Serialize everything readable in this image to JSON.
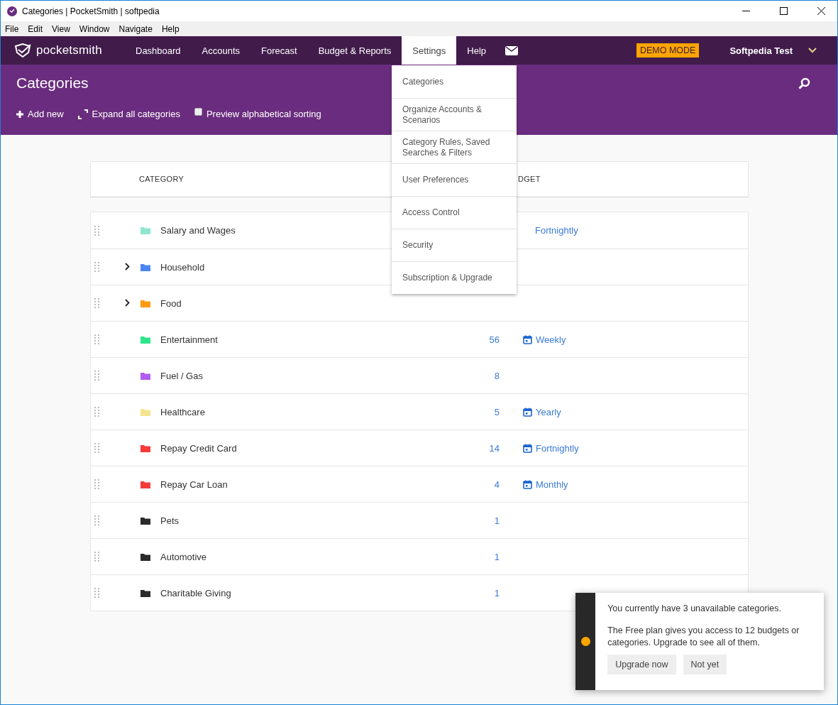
{
  "window": {
    "title": "Categories | PocketSmith | softpedia"
  },
  "menubar": [
    "File",
    "Edit",
    "View",
    "Window",
    "Navigate",
    "Help"
  ],
  "nav": {
    "brand": "pocketsmith",
    "items": [
      {
        "label": "Dashboard",
        "selected": false
      },
      {
        "label": "Accounts",
        "selected": false
      },
      {
        "label": "Forecast",
        "selected": false
      },
      {
        "label": "Budget & Reports",
        "selected": false
      },
      {
        "label": "Settings",
        "selected": true
      },
      {
        "label": "Help",
        "selected": false
      }
    ],
    "demo_badge": "DEMO MODE",
    "user": "Softpedia Test"
  },
  "settings_menu": [
    "Categories",
    "Organize Accounts & Scenarios",
    "Category Rules, Saved Searches & Filters",
    "User Preferences",
    "Access Control",
    "Security",
    "Subscription & Upgrade"
  ],
  "page": {
    "title": "Categories",
    "actions": {
      "add": "Add new",
      "expand": "Expand all categories",
      "preview": {
        "label": "Preview alphabetical sorting",
        "checked": false
      }
    }
  },
  "table": {
    "columns": [
      "CATEGORY",
      "DGET"
    ],
    "rows": [
      {
        "name": "Salary and Wages",
        "color": "#8ee6cf",
        "expandable": false,
        "budget": "Fortnightly",
        "calendar": false
      },
      {
        "name": "Household",
        "color": "#4a86f0",
        "expandable": true
      },
      {
        "name": "Food",
        "color": "#ff9a0e",
        "expandable": true
      },
      {
        "name": "Entertainment",
        "color": "#2ee68a",
        "expandable": false,
        "count": "56",
        "budget": "Weekly",
        "calendar": true
      },
      {
        "name": "Fuel / Gas",
        "color": "#b05cf0",
        "expandable": false,
        "count": "8"
      },
      {
        "name": "Healthcare",
        "color": "#f5e48e",
        "expandable": false,
        "count": "5",
        "budget": "Yearly",
        "calendar": true
      },
      {
        "name": "Repay Credit Card",
        "color": "#f53a3a",
        "expandable": false,
        "count": "14",
        "budget": "Fortnightly",
        "calendar": true
      },
      {
        "name": "Repay Car Loan",
        "color": "#f53a3a",
        "expandable": false,
        "count": "4",
        "budget": "Monthly",
        "calendar": true
      },
      {
        "name": "Pets",
        "color": "#2a2a2a",
        "expandable": false,
        "count": "1"
      },
      {
        "name": "Automotive",
        "color": "#2a2a2a",
        "expandable": false,
        "count": "1"
      },
      {
        "name": "Charitable Giving",
        "color": "#2a2a2a",
        "expandable": false,
        "count": "1"
      }
    ]
  },
  "toast": {
    "lines": [
      "You currently have 3 unavailable categories.",
      "The Free plan gives you access to 12 budgets or categories. Upgrade to see all of them."
    ],
    "buttons": [
      "Upgrade now",
      "Not yet"
    ]
  }
}
